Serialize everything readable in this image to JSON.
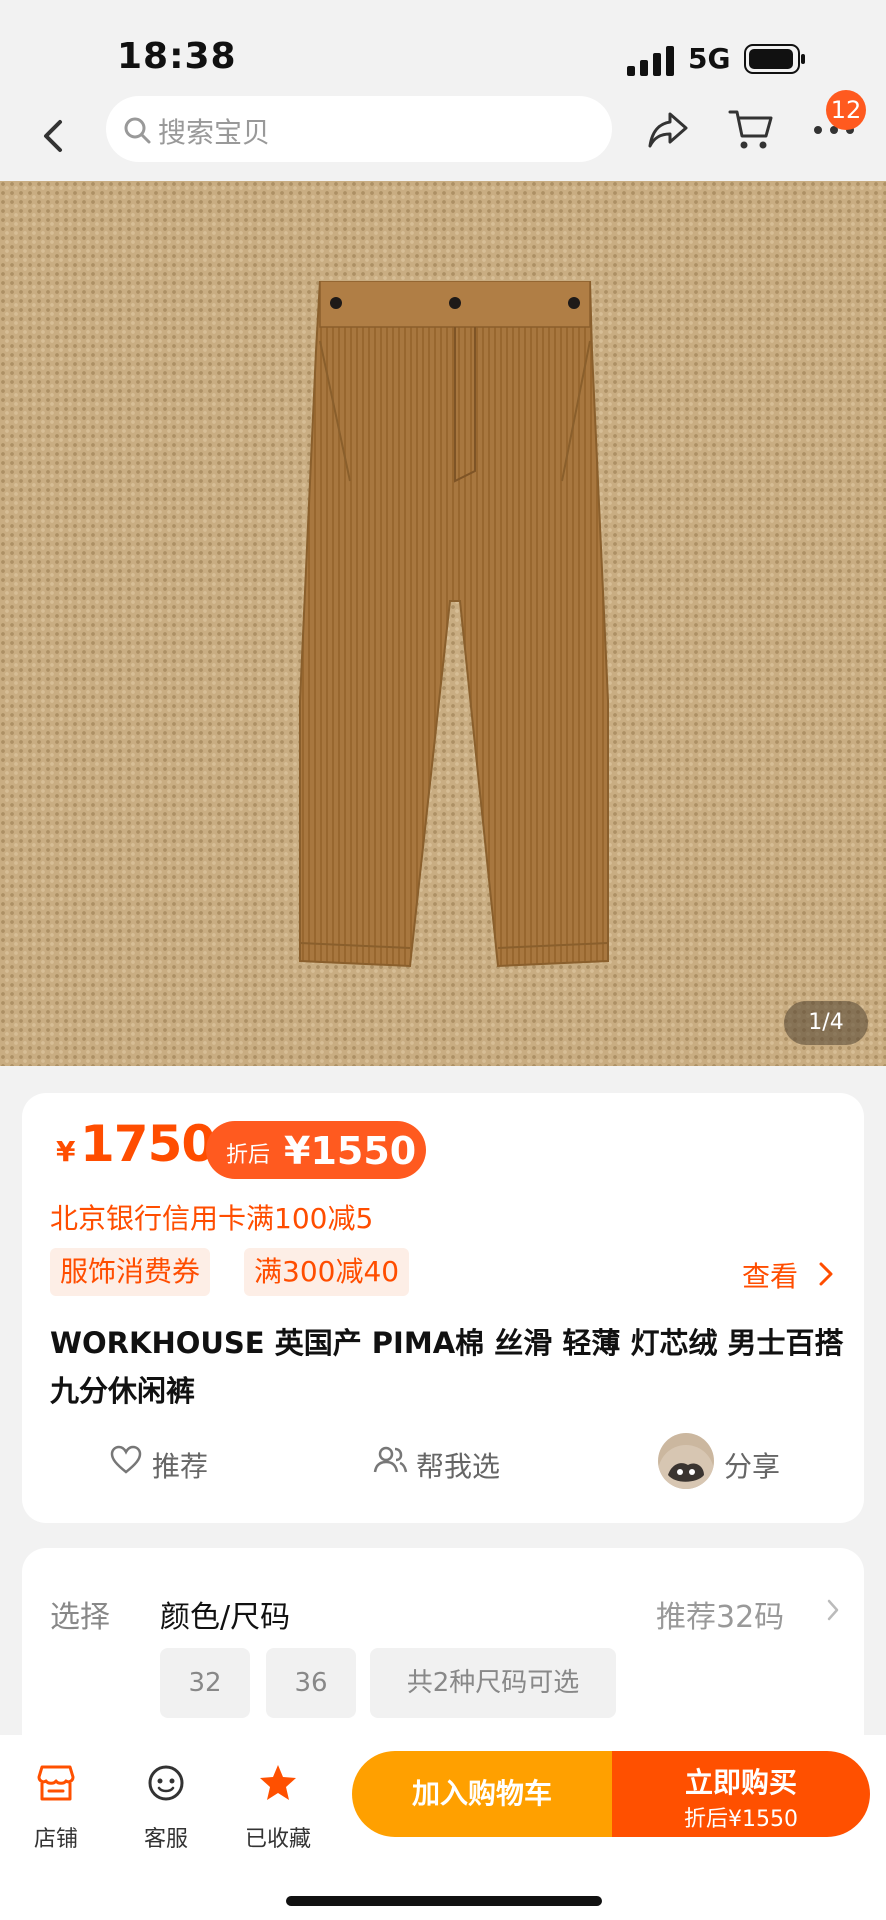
{
  "status_bar": {
    "time": "18:38",
    "network": "5G"
  },
  "nav": {
    "search_placeholder": "搜索宝贝",
    "cart_badge": "12"
  },
  "gallery": {
    "counter": "1/4"
  },
  "price_card": {
    "currency": "¥",
    "price": "1750",
    "after_label": "折后",
    "after_price": "¥1550",
    "bank_promo": "北京银行信用卡满100减5",
    "coupons": [
      "服饰消费券",
      "满300减40"
    ],
    "view_label": "查看",
    "title": "WORKHOUSE 英国产 PIMA棉 丝滑 轻薄 灯芯绒 男士百搭九分休闲裤",
    "actions": {
      "recommend": "推荐",
      "help_choose": "帮我选",
      "share": "分享"
    }
  },
  "select_card": {
    "label": "选择",
    "value": "颜色/尺码",
    "recommend": "推荐32码",
    "sizes": [
      "32",
      "36"
    ],
    "more": "共2种尺码可选"
  },
  "bottom_bar": {
    "tabs": [
      "店铺",
      "客服",
      "已收藏"
    ],
    "add_to_cart": "加入购物车",
    "buy_now": "立即购买",
    "buy_sub": "折后¥1550"
  },
  "colors": {
    "accent": "#ff5000",
    "cart_button": "#ffa000",
    "promo_bg": "#fdeee6"
  }
}
